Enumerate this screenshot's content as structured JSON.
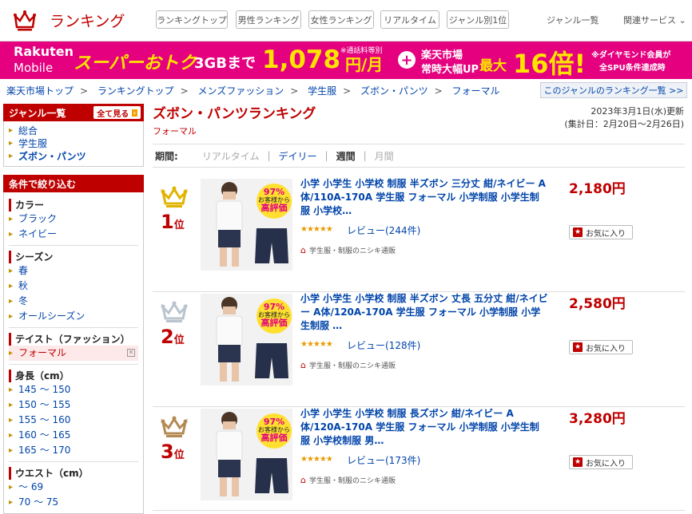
{
  "header": {
    "title": "ランキング",
    "nav": [
      "ランキングトップ",
      "男性ランキング",
      "女性ランキング",
      "リアルタイム",
      "ジャンル別1位"
    ],
    "genre_list": "ジャンル一覧",
    "related": "関連サービス"
  },
  "banner": {
    "rakuten": "Rakuten",
    "mobile": "Mobile",
    "super": "スーパーおトク",
    "gb": "3GBまで",
    "price": "1,078",
    "unit": "円/月",
    "note": "※通話料等別",
    "plus": "+",
    "line1": "楽天市場",
    "line2": "常時大幅UP",
    "max": "最大",
    "times": "16倍!",
    "dia1": "※ダイヤモンド会員が",
    "dia2": "全SPU条件達成時"
  },
  "breadcrumb": [
    "楽天市場トップ",
    "ランキングトップ",
    "メンズファッション",
    "学生服",
    "ズボン・パンツ",
    "フォーマル"
  ],
  "other_genre_link": "このジャンルのランキング一覧 >>",
  "sidebar": {
    "genre_title": "ジャンル一覧",
    "all_button": "全て見る",
    "genres": [
      "総合",
      "学生服",
      "ズボン・パンツ"
    ],
    "filter_title": "条件で絞り込む",
    "sections": [
      {
        "title": "カラー",
        "items": [
          "ブラック",
          "ネイビー"
        ]
      },
      {
        "title": "シーズン",
        "items": [
          "春",
          "秋",
          "冬",
          "オールシーズン"
        ]
      },
      {
        "title": "テイスト（ファッション）",
        "items": [
          "フォーマル"
        ]
      },
      {
        "title": "身長（cm）",
        "items": [
          "145 ～ 150",
          "150 ～ 155",
          "155 ～ 160",
          "160 ～ 165",
          "165 ～ 170"
        ]
      },
      {
        "title": "ウエスト（cm）",
        "items": [
          "～ 69",
          "70 ～ 75"
        ]
      }
    ]
  },
  "main": {
    "title": "ズボン・パンツランキング",
    "subtitle": "フォーマル",
    "updated": "2023年3月1日(水)更新",
    "period": "(集計日：2月20日～2月26日)",
    "period_label": "期間:",
    "period_options": [
      "リアルタイム",
      "デイリー",
      "週間",
      "月間"
    ]
  },
  "items": [
    {
      "rank": "1",
      "rank_suffix": "位",
      "crown_color": "#e0b400",
      "title": "小学 小学生 小学校 制服 半ズボン 三分丈 紺/ネイビー A体/110A-170A 学生服 フォーマル 小学制服 小学生制服 小学校…",
      "price": "2,180円",
      "stars": "★★★★★",
      "review": "レビュー(244件)",
      "shop": "学生服・制服のニシキ通販",
      "fav": "お気に入り"
    },
    {
      "rank": "2",
      "rank_suffix": "位",
      "crown_color": "#b9c4ce",
      "title": "小学 小学生 小学校 制服 半ズボン 丈長 五分丈 紺/ネイビー A体/120A-170A 学生服 フォーマル 小学制服 小学生制服 …",
      "price": "2,580円",
      "stars": "★★★★★",
      "review": "レビュー(128件)",
      "shop": "学生服・制服のニシキ通販",
      "fav": "お気に入り"
    },
    {
      "rank": "3",
      "rank_suffix": "位",
      "crown_color": "#b38a53",
      "title": "小学 小学生 小学校 制服 長ズボン 紺/ネイビー A体/120A-170A 学生服 フォーマル 小学制服 小学生制服 小学校制服 男…",
      "price": "3,280円",
      "stars": "★★★★★",
      "review": "レビュー(173件)",
      "shop": "学生服・制服のニシキ通販",
      "fav": "お気に入り"
    }
  ],
  "thumb_badge": {
    "pct": "97%",
    "line1": "以上の",
    "line2": "お客様から",
    "line3": "高評価"
  }
}
